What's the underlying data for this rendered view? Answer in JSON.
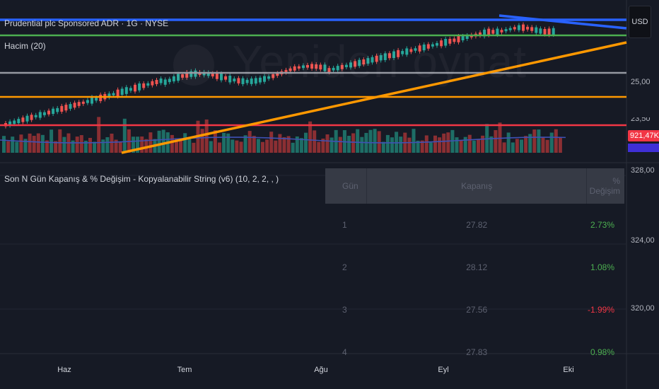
{
  "header": {
    "symbol_title": "Prudential plc Sponsored ADR · 1G · NYSE",
    "volume_label": "Hacim (20)"
  },
  "watermark": {
    "text": "Yeniden oynat"
  },
  "price_scale": {
    "currency": "USD",
    "labels": [
      "25,00",
      "23,50"
    ],
    "volume_badge": "921,47K"
  },
  "indicator": {
    "title": "Son N Gün Kapanış & % Değişim - Kopyalanabilir String (v6) (10, 2, 2, , )",
    "scale_labels": [
      "328,00",
      "324,00",
      "320,00"
    ],
    "table": {
      "headers": [
        "Gün",
        "Kapanış",
        "% Değişim"
      ],
      "rows": [
        {
          "day": "1",
          "close": "27.82",
          "change": "2.73%",
          "dir": "up"
        },
        {
          "day": "2",
          "close": "28.12",
          "change": "1.08%",
          "dir": "up"
        },
        {
          "day": "3",
          "close": "27.56",
          "change": "-1.99%",
          "dir": "down"
        },
        {
          "day": "4",
          "close": "27.83",
          "change": "0.98%",
          "dir": "up"
        }
      ]
    }
  },
  "time_axis": {
    "labels": [
      "Haz",
      "Tem",
      "Ağu",
      "Eyl",
      "Eki"
    ]
  },
  "colors": {
    "background": "#161a25",
    "up": "#26a69a",
    "down": "#ef5350",
    "blue_line": "#2962ff",
    "green_line": "#4caf50",
    "orange_line": "#ff9800",
    "red_line": "#f23645",
    "gray_line": "#9598a1"
  }
}
